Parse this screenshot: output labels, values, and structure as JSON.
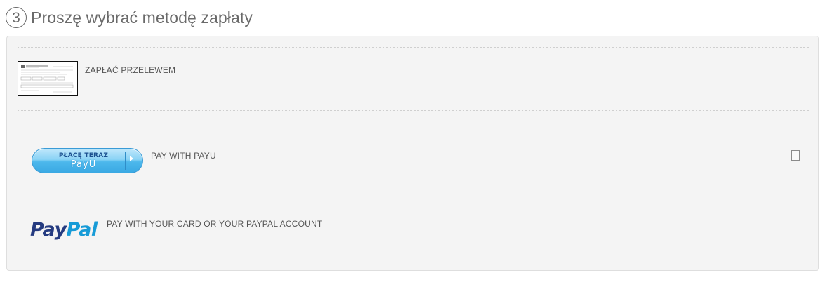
{
  "step": {
    "number": "3",
    "title": "Proszę wybrać metodę zapłaty"
  },
  "methods": [
    {
      "id": "transfer",
      "label": "ZAPŁAĆ PRZELEWEM",
      "logo": "bank-transfer-form-icon"
    },
    {
      "id": "payu",
      "label": "PAY WITH PAYU",
      "logo": "payu-button",
      "button_top": "PŁACĘ TERAZ",
      "button_bottom": "PayU",
      "checked": false
    },
    {
      "id": "paypal",
      "label": "PAY WITH YOUR CARD OR YOUR PAYPAL ACCOUNT",
      "logo": "paypal-logo",
      "logo_pay": "Pay",
      "logo_pal": "Pal"
    }
  ],
  "colors": {
    "panel_bg": "#f4f4f4",
    "text": "#555555",
    "payu_blue": "#3aa9e3",
    "paypal_dark": "#253b80",
    "paypal_light": "#179bd7"
  }
}
